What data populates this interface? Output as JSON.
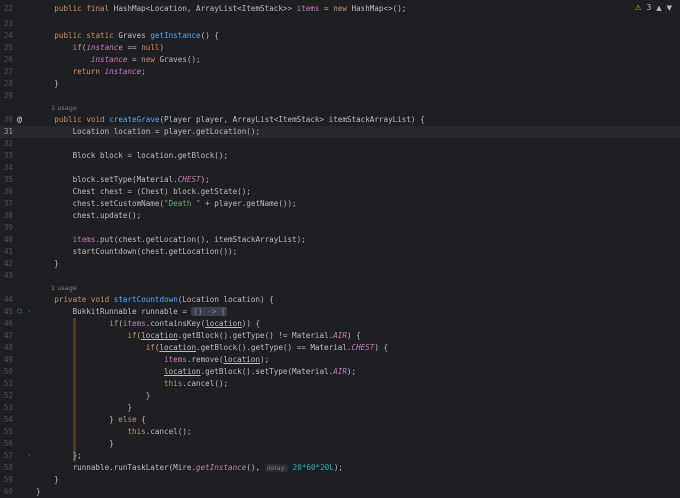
{
  "status": {
    "warning_count": "3",
    "up": "▲",
    "down": "▼"
  },
  "usages": {
    "l1": "1 usage",
    "l2": "1 usage"
  },
  "gutter": {
    "at_marker": "@",
    "override_marker": "⬡"
  },
  "lines": [
    {
      "n": "22",
      "t": ""
    },
    {
      "n": "23",
      "t": ""
    },
    {
      "n": "24",
      "t": ""
    },
    {
      "n": "25",
      "t": ""
    },
    {
      "n": "26",
      "t": ""
    },
    {
      "n": "27",
      "t": ""
    },
    {
      "n": "28",
      "t": ""
    },
    {
      "n": "29",
      "t": ""
    },
    {
      "n": "30",
      "t": ""
    },
    {
      "n": "31",
      "t": ""
    },
    {
      "n": "32",
      "t": ""
    },
    {
      "n": "33",
      "t": ""
    },
    {
      "n": "34",
      "t": ""
    },
    {
      "n": "35",
      "t": ""
    },
    {
      "n": "36",
      "t": ""
    },
    {
      "n": "37",
      "t": ""
    },
    {
      "n": "38",
      "t": ""
    },
    {
      "n": "39",
      "t": ""
    },
    {
      "n": "40",
      "t": ""
    },
    {
      "n": "41",
      "t": ""
    },
    {
      "n": "42",
      "t": ""
    },
    {
      "n": "43",
      "t": ""
    },
    {
      "n": "44",
      "t": ""
    },
    {
      "n": "45",
      "t": ""
    },
    {
      "n": "46",
      "t": ""
    },
    {
      "n": "47",
      "t": ""
    },
    {
      "n": "48",
      "t": ""
    },
    {
      "n": "49",
      "t": ""
    },
    {
      "n": "50",
      "t": ""
    },
    {
      "n": "51",
      "t": ""
    },
    {
      "n": "52",
      "t": ""
    },
    {
      "n": "53",
      "t": ""
    },
    {
      "n": "54",
      "t": ""
    },
    {
      "n": "55",
      "t": ""
    },
    {
      "n": "56",
      "t": ""
    },
    {
      "n": "57",
      "t": ""
    },
    {
      "n": "58",
      "t": ""
    },
    {
      "n": "59",
      "t": ""
    },
    {
      "n": "60",
      "t": ""
    }
  ],
  "code_text": {
    "l0": "    public final HashMap<Location, ArrayList<ItemStack>> items = new HashMap<>();",
    "l2": "    public static Graves getInstance() {",
    "l3": "        if(instance == null)",
    "l4": "            instance = new Graves();",
    "l5": "        return instance;",
    "l6": "    }",
    "l8": "    public void createGrave(Player player, ArrayList<ItemStack> itemStackArrayList) {",
    "l9": "        Location location = player.getLocation();",
    "l11": "        Block block = location.getBlock();",
    "l13": "        block.setType(Material.CHEST);",
    "l14": "        Chest chest = (Chest) block.getState();",
    "l15": "        chest.setCustomName(\"Death \" + player.getName());",
    "l16": "        chest.update();",
    "l18": "        items.put(chest.getLocation(), itemStackArrayList);",
    "l19": "        startCountdown(chest.getLocation());",
    "l20": "    }",
    "l22": "    private void startCountdown(Location location) {",
    "l23": "        BukkitRunnable runnable = () -> {",
    "l24": "                if(items.containsKey(location)) {",
    "l25": "                    if(location.getBlock().getType() != Material.AIR) {",
    "l26": "                        if(location.getBlock().getType() == Material.CHEST) {",
    "l27": "                            items.remove(location);",
    "l28": "                            location.getBlock().setType(Material.AIR);",
    "l29": "                            this.cancel();",
    "l30": "                        }",
    "l31": "                    }",
    "l32": "                } else {",
    "l33": "                    this.cancel();",
    "l34": "                }",
    "l35": "        };",
    "l36": "        runnable.runTaskLater(Mire.getInstance(), delay: 20*60*20L);",
    "l37": "    }",
    "l38": "}"
  },
  "tokens": {
    "public": "public",
    "final": "final",
    "static": "static",
    "void": "void",
    "private": "private",
    "new": "new",
    "return": "return",
    "if": "if",
    "else": "else",
    "null": "null",
    "this": "this",
    "HashMap": "HashMap",
    "Location": "Location",
    "ArrayList": "ArrayList",
    "ItemStack": "ItemStack",
    "items": "items",
    "Graves": "Graves",
    "getInstance": "getInstance",
    "instance": "instance",
    "createGrave": "createGrave",
    "Player": "Player",
    "player": "player",
    "itemStackArrayList": "itemStackArrayList",
    "location": "location",
    "getLocation": "getLocation",
    "Block": "Block",
    "block": "block",
    "getBlock": "getBlock",
    "setType": "setType",
    "Material": "Material",
    "CHEST": "CHEST",
    "Chest": "Chest",
    "chest": "chest",
    "getState": "getState",
    "setCustomName": "setCustomName",
    "death_str": "\"Death \"",
    "getName": "getName",
    "update": "update",
    "put": "put",
    "startCountdown": "startCountdown",
    "BukkitRunnable": "BukkitRunnable",
    "runnable": "runnable",
    "lambda": "() -> {",
    "containsKey": "containsKey",
    "getType": "getType",
    "AIR": "AIR",
    "remove": "remove",
    "cancel": "cancel",
    "runTaskLater": "runTaskLater",
    "Mire": "Mire",
    "delay_label": "delay:",
    "delay_value": "20*60*20L"
  }
}
